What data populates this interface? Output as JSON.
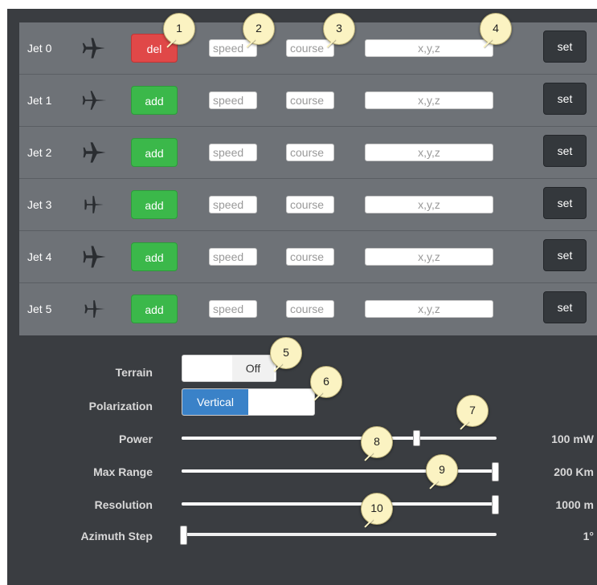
{
  "jets": [
    {
      "label": "Jet 0",
      "plane_icon": "plane-icon",
      "action_label": "del",
      "action_type": "del",
      "speed_placeholder": "speed",
      "course_placeholder": "course",
      "xyz_placeholder": "x,y,z",
      "set_label": "set"
    },
    {
      "label": "Jet 1",
      "plane_icon": "plane-icon",
      "action_label": "add",
      "action_type": "add",
      "speed_placeholder": "speed",
      "course_placeholder": "course",
      "xyz_placeholder": "x,y,z",
      "set_label": "set"
    },
    {
      "label": "Jet 2",
      "plane_icon": "plane-icon",
      "action_label": "add",
      "action_type": "add",
      "speed_placeholder": "speed",
      "course_placeholder": "course",
      "xyz_placeholder": "x,y,z",
      "set_label": "set"
    },
    {
      "label": "Jet 3",
      "plane_icon": "plane-icon",
      "action_label": "add",
      "action_type": "add",
      "speed_placeholder": "speed",
      "course_placeholder": "course",
      "xyz_placeholder": "x,y,z",
      "set_label": "set"
    },
    {
      "label": "Jet 4",
      "plane_icon": "plane-icon",
      "action_label": "add",
      "action_type": "add",
      "speed_placeholder": "speed",
      "course_placeholder": "course",
      "xyz_placeholder": "x,y,z",
      "set_label": "set"
    },
    {
      "label": "Jet 5",
      "plane_icon": "plane-icon",
      "action_label": "add",
      "action_type": "add",
      "speed_placeholder": "speed",
      "course_placeholder": "course",
      "xyz_placeholder": "x,y,z",
      "set_label": "set"
    }
  ],
  "settings": {
    "terrain": {
      "label": "Terrain",
      "value": "Off"
    },
    "polarization": {
      "label": "Polarization",
      "value": "Vertical"
    },
    "power": {
      "label": "Power",
      "value": "100 mW",
      "level": 0.75
    },
    "max_range": {
      "label": "Max Range",
      "value": "200 Km",
      "level": 1.0
    },
    "resolution": {
      "label": "Resolution",
      "value": "1000 m",
      "level": 1.0
    },
    "azimuth_step": {
      "label": "Azimuth Step",
      "value": "1°",
      "level": 0.0
    }
  },
  "callouts": [
    "1",
    "2",
    "3",
    "4",
    "5",
    "6",
    "7",
    "8",
    "9",
    "10"
  ],
  "colors": {
    "add": "#3bb84a",
    "del": "#e04848",
    "set": "#34383c",
    "polarization_active": "#3a82c8",
    "callout": "#fbf3c2"
  }
}
